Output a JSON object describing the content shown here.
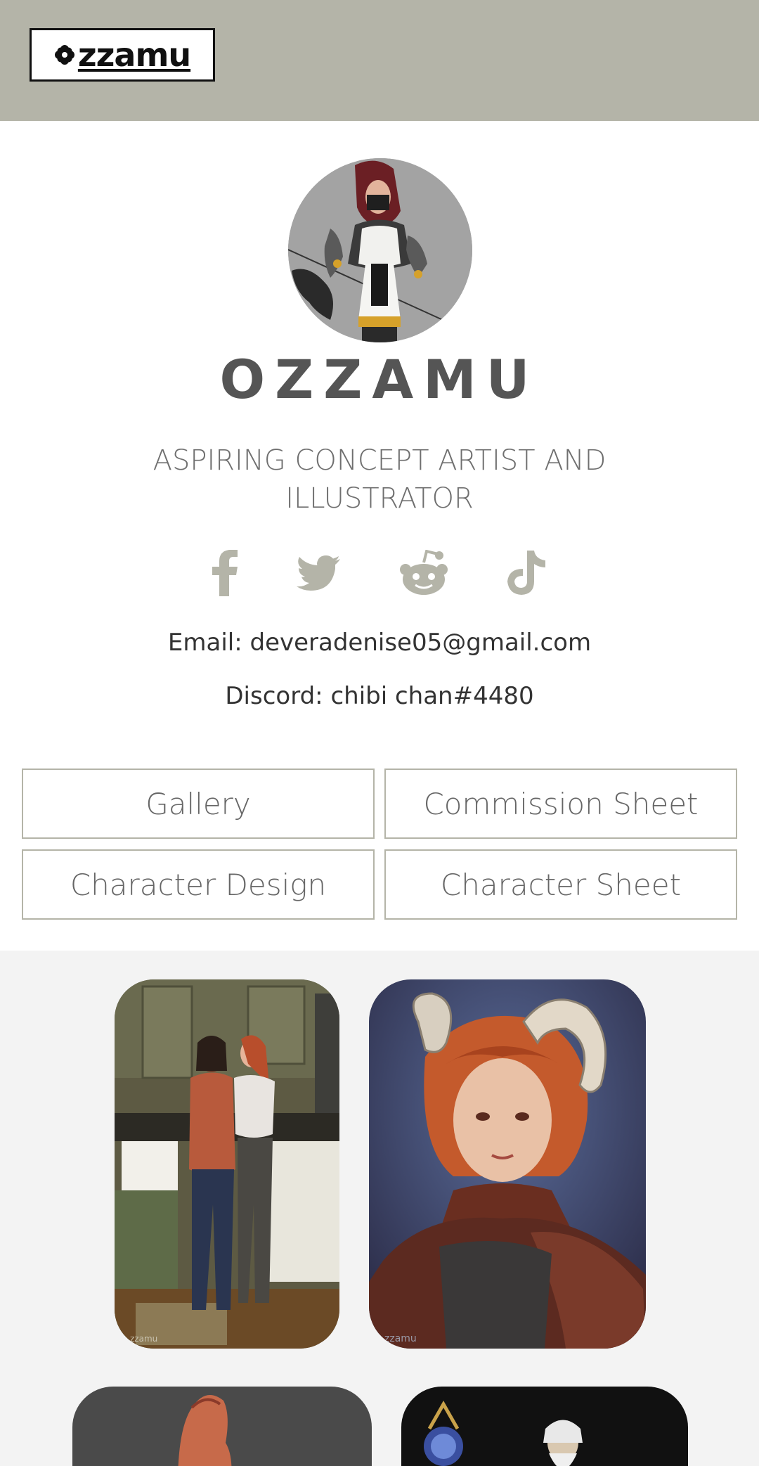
{
  "header": {
    "logo_text": "zzamu"
  },
  "profile": {
    "name": "OZZAMU",
    "tagline": "ASPIRING CONCEPT ARTIST AND ILLUSTRATOR",
    "email_label": "Email:",
    "email": "deveradenise05@gmail.com",
    "discord_label": "Discord:",
    "discord": "chibi chan#4480"
  },
  "social": [
    {
      "icon": "facebook-icon"
    },
    {
      "icon": "twitter-icon"
    },
    {
      "icon": "reddit-icon"
    },
    {
      "icon": "tiktok-icon"
    }
  ],
  "links": [
    {
      "label": "Gallery"
    },
    {
      "label": "Commission Sheet"
    },
    {
      "label": "Character Design"
    },
    {
      "label": "Character Sheet"
    }
  ],
  "gallery": {
    "watermark": "zzamu"
  },
  "colors": {
    "accent": "#b4b4a8",
    "gallery_bg": "#f3f3f3"
  }
}
